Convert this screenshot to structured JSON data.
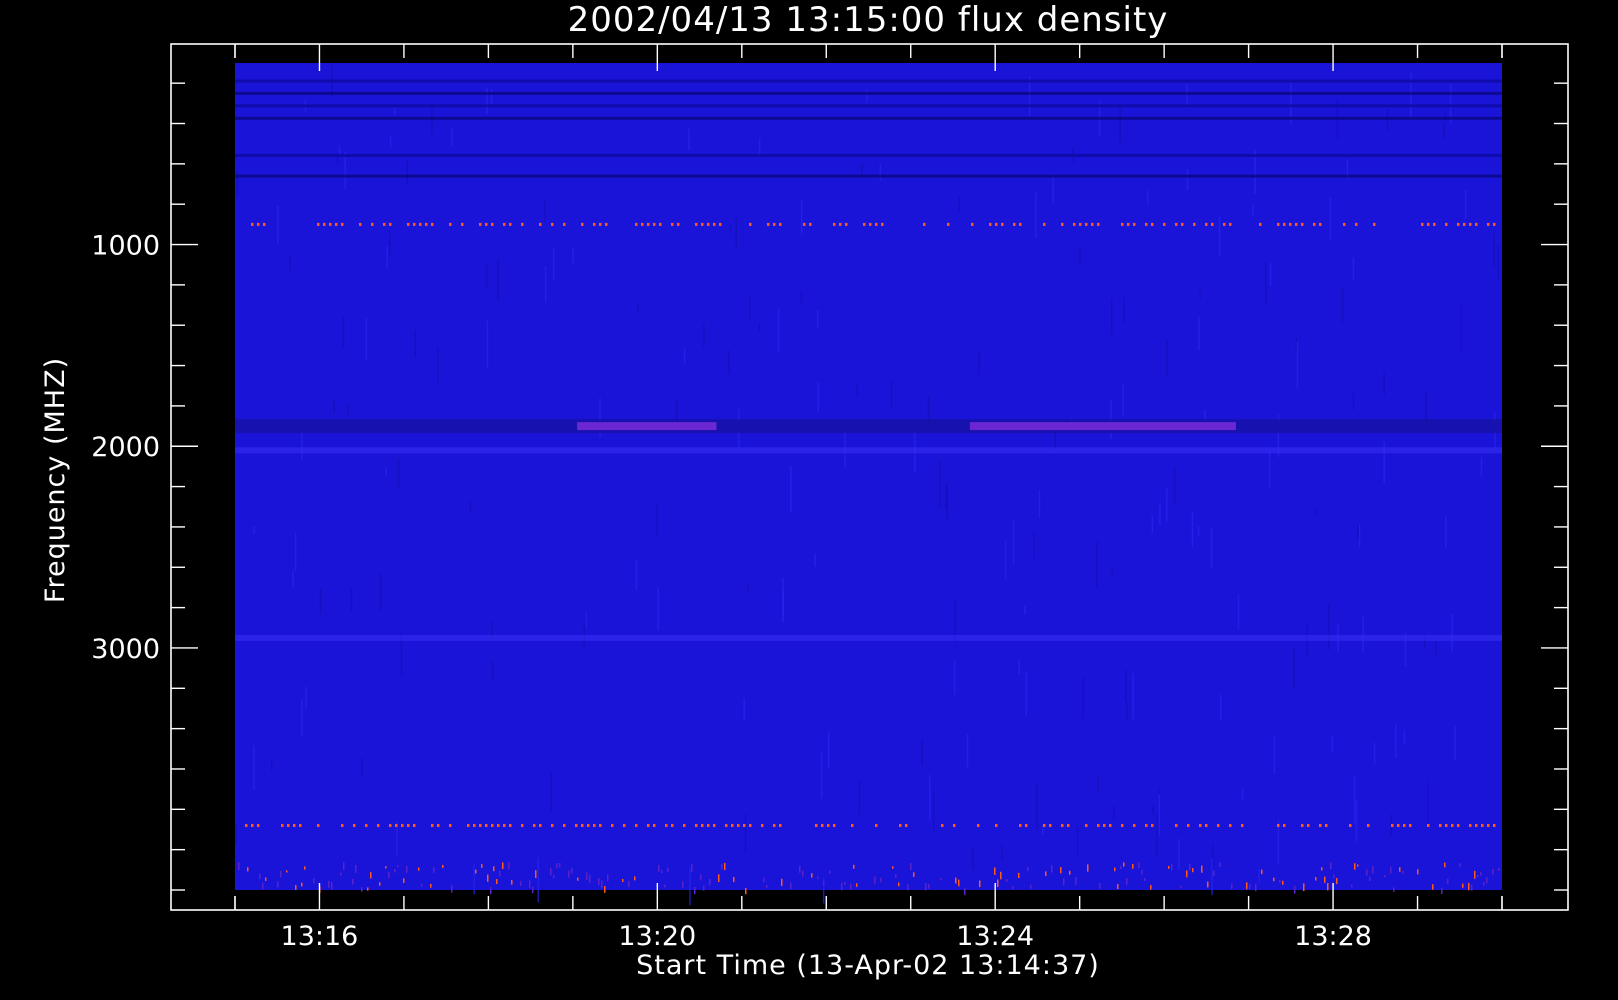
{
  "chart_data": {
    "type": "heatmap",
    "title": "2002/04/13 13:15:00 flux density",
    "xlabel": "Start Time (13-Apr-02 13:14:37)",
    "ylabel": "Frequency (MHZ)",
    "x_axis": {
      "range": [
        "13:15:00",
        "13:30:00"
      ],
      "major_ticks": [
        "13:16",
        "13:20",
        "13:24",
        "13:28"
      ],
      "minor_tick_interval_minutes": 1
    },
    "y_axis": {
      "range": [
        100,
        4200
      ],
      "inverted": true,
      "major_ticks": [
        1000,
        2000,
        3000
      ],
      "minor_tick_interval": 200
    },
    "colors": {
      "background": "#000000",
      "frame": "#ffffff",
      "base_flux": "#1a14d8",
      "enhanced_flux": "#7a2bd8",
      "hot_flux": "#ff5a1a"
    },
    "features": [
      {
        "kind": "narrowband_interference",
        "freq_mhz": 900,
        "level": "hot"
      },
      {
        "kind": "enhanced_band",
        "freq_mhz": 1900,
        "level": "enhanced"
      },
      {
        "kind": "noise_band",
        "freq_mhz": 2020,
        "level": "enhanced"
      },
      {
        "kind": "noise_band",
        "freq_mhz": 2950,
        "level": "enhanced"
      },
      {
        "kind": "narrowband_interference",
        "freq_mhz": 3880,
        "level": "hot"
      }
    ],
    "grid": false,
    "legend": "none"
  }
}
